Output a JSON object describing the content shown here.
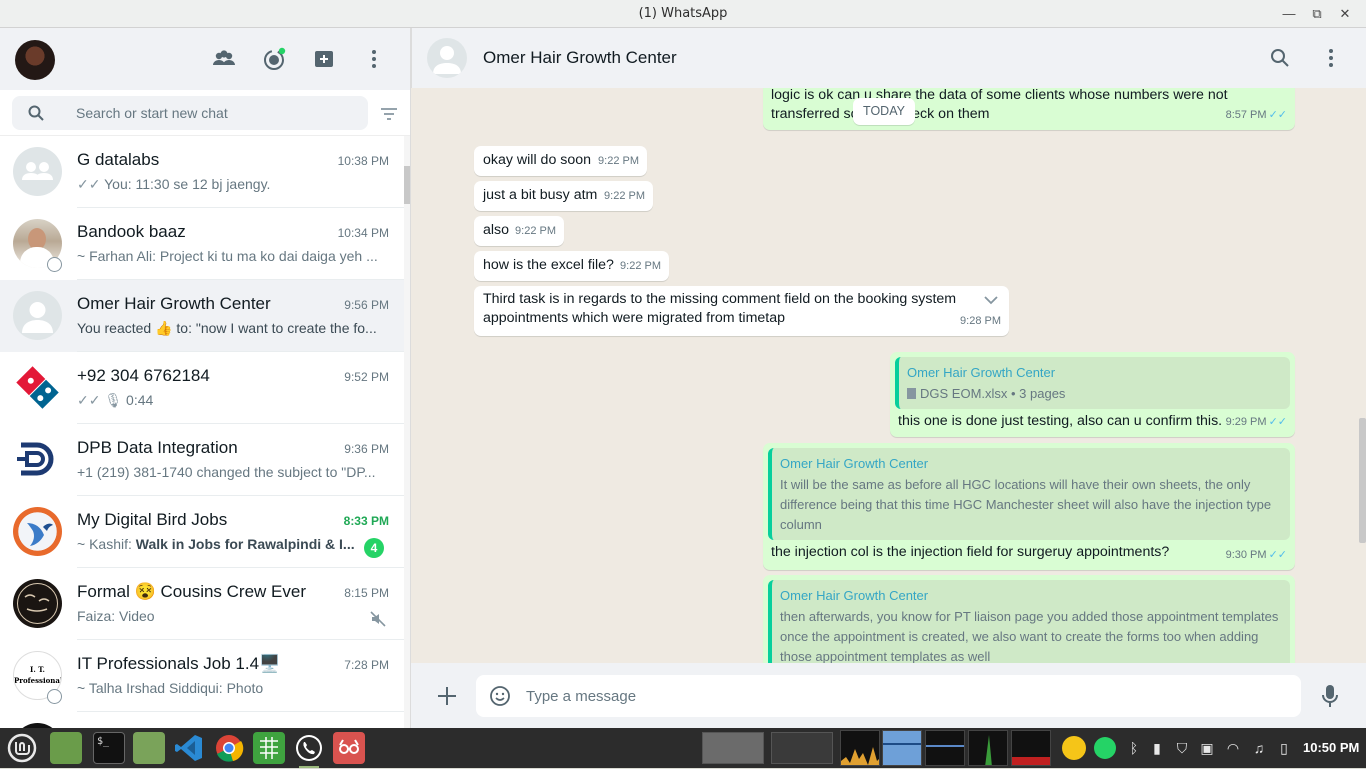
{
  "window": {
    "title": "(1) WhatsApp"
  },
  "sidebar": {
    "search_placeholder": "Search or start new chat",
    "chats": [
      {
        "name": "G datalabs",
        "time": "10:38 PM",
        "last": "You: 11:30 se 12 bj jaengy.",
        "ticks": "✓✓",
        "unread": ""
      },
      {
        "name": "Bandook baaz",
        "time": "10:34 PM",
        "last": "~ Farhan Ali: Project ki tu ma ko dai daiga yeh ...",
        "ticks": "",
        "unread": ""
      },
      {
        "name": "Omer Hair Growth Center",
        "time": "9:56 PM",
        "last": "You reacted 👍 to: \"now I want to create the fo...",
        "ticks": "",
        "unread": ""
      },
      {
        "name": "+92 304 6762184",
        "time": "9:52 PM",
        "last": "0:44",
        "ticks": "✓✓",
        "unread": ""
      },
      {
        "name": "DPB Data Integration",
        "time": "9:36 PM",
        "last": "+1 (219) 381-1740 changed the subject to \"DP...",
        "ticks": "",
        "unread": ""
      },
      {
        "name": "My Digital Bird Jobs",
        "time": "8:33 PM",
        "last": "~ Kashif: Walk in Jobs for Rawalpindi & I...",
        "ticks": "",
        "unread": "4"
      },
      {
        "name": "Formal 😵 Cousins Crew Ever",
        "time": "8:15 PM",
        "last": "Faiza: Video",
        "ticks": "",
        "unread": ""
      },
      {
        "name": "IT Professionals Job 1.4🖥️",
        "time": "7:28 PM",
        "last": "~ Talha Irshad Siddiqui: Photo",
        "ticks": "",
        "unread": ""
      }
    ],
    "bandook_preview": "~ Farhan Ali: Project ki tu ma ko dai daiga yeh ...",
    "mdb_sender": "~ Kashif: ",
    "mdb_bold": "Walk in Jobs for Rawalpindi & I...",
    "it_prof_label": "I. T. Professional"
  },
  "conversation": {
    "name": "Omer Hair Growth Center",
    "date_divider": "TODAY",
    "composer_placeholder": "Type a message",
    "messages": [
      {
        "dir": "out",
        "text": "logic is ok can u share the data of some clients whose numbers were not transferred so I can check on them",
        "time": "8:57 PM"
      },
      {
        "dir": "in",
        "text": "okay will do soon",
        "time": "9:22 PM"
      },
      {
        "dir": "in",
        "text": "just a bit busy atm",
        "time": "9:22 PM"
      },
      {
        "dir": "in",
        "text": "also",
        "time": "9:22 PM"
      },
      {
        "dir": "in",
        "text": "how is the excel file?",
        "time": "9:22 PM"
      },
      {
        "dir": "in",
        "text": "Third task is in regards to the missing comment field on the booking system appointments which were migrated from timetap",
        "time": "9:28 PM"
      },
      {
        "dir": "out",
        "quote_name": "Omer Hair Growth Center",
        "quote_text": "DGS EOM.xlsx • 3 pages",
        "text": "this one is done just testing, also can u confirm this.",
        "time": "9:29 PM"
      },
      {
        "dir": "out",
        "quote_name": "Omer Hair Growth Center",
        "quote_text": "It will be the same as before all HGC locations will have their own sheets, the only difference being that this time HGC Manchester sheet will also have the injection type column",
        "text": "the injection col is the injection field for surgeruy appointments?",
        "time": "9:30 PM"
      },
      {
        "dir": "out",
        "quote_name": "Omer Hair Growth Center",
        "quote_text": "then afterwards, you know for PT liaison page you added those appointment templates once the appointment is created, we also want to create the forms too when adding those appointment templates as well",
        "text": "",
        "time": ""
      }
    ]
  },
  "taskbar": {
    "clock": "10:50 PM"
  },
  "colors": {
    "accent": "#25d366",
    "outgoing": "#d9fdd3",
    "read_tick": "#53bdeb"
  }
}
